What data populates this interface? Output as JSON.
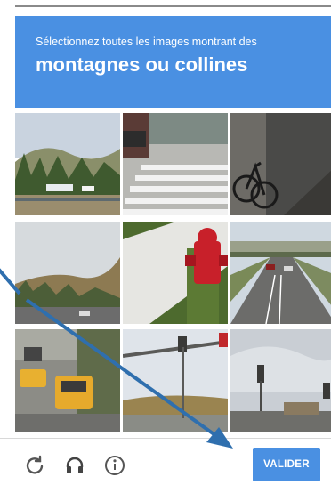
{
  "captcha": {
    "instruction": "Sélectionnez toutes les images montrant des",
    "target": "montagnes ou collines"
  },
  "tiles": [
    {
      "content": "hills-with-trees-and-cars"
    },
    {
      "content": "crosswalk-with-car"
    },
    {
      "content": "bicycle-on-sidewalk"
    },
    {
      "content": "road-with-hills"
    },
    {
      "content": "fire-hydrant"
    },
    {
      "content": "highway-overpass"
    },
    {
      "content": "taxis-on-street"
    },
    {
      "content": "traffic-signal-pole"
    },
    {
      "content": "traffic-light-cloudy-sky"
    }
  ],
  "footer": {
    "reload_icon": "reload-icon",
    "audio_icon": "headphones-icon",
    "help_icon": "info-icon",
    "verify_label": "VALIDER"
  },
  "colors": {
    "accent": "#4a90e2",
    "arrow": "#2f6fae"
  }
}
